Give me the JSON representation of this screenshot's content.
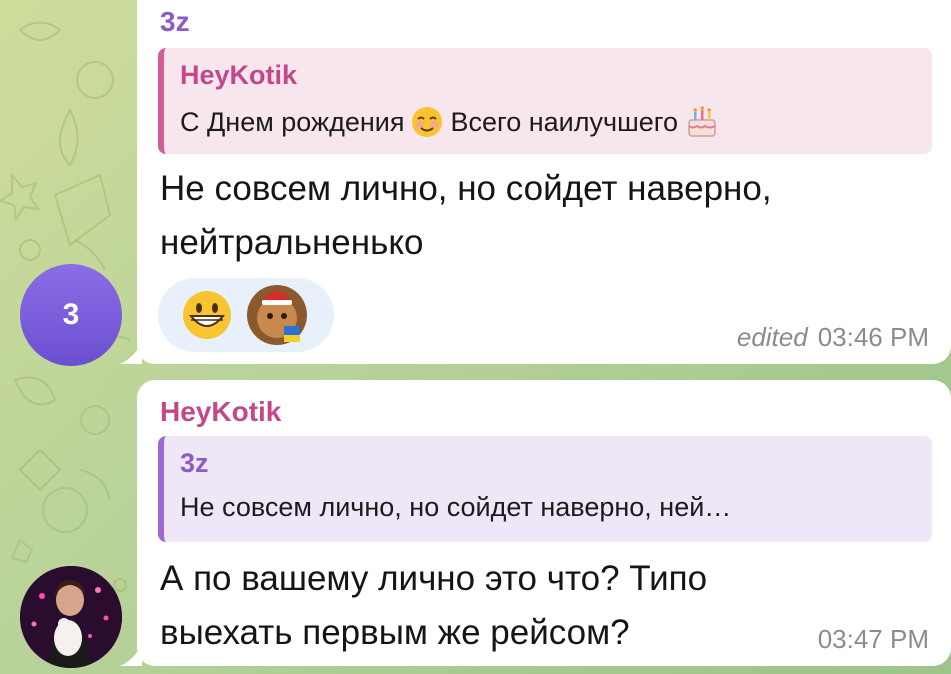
{
  "messages": [
    {
      "sender": "3z",
      "sender_color": "#8b5cc7",
      "avatar_initial": "3",
      "reply": {
        "author": "HeyKotik",
        "text_part1": "С Днем рождения",
        "text_part2": "Всего наилучшего"
      },
      "text": "Не совсем лично, но сойдет наверно, нейтральненько",
      "reactions": [
        "grinning-face-emoji",
        "custom-cat-santa-emoji"
      ],
      "edited_label": "edited",
      "time": "03:46 PM"
    },
    {
      "sender": "HeyKotik",
      "sender_color": "#c4478a",
      "reply": {
        "author": "3z",
        "text": "Не совсем лично, но сойдет наверно, ней…"
      },
      "text": "А по вашему лично это что? Типо выехать первым же рейсом?",
      "time": "03:47 PM"
    }
  ],
  "colors": {
    "bubble": "#ffffff",
    "reply_pink": "#f8e6ee",
    "reply_purple": "#efe7f7",
    "reaction_bg": "#e8f1fb",
    "meta": "#8c8c8c"
  }
}
